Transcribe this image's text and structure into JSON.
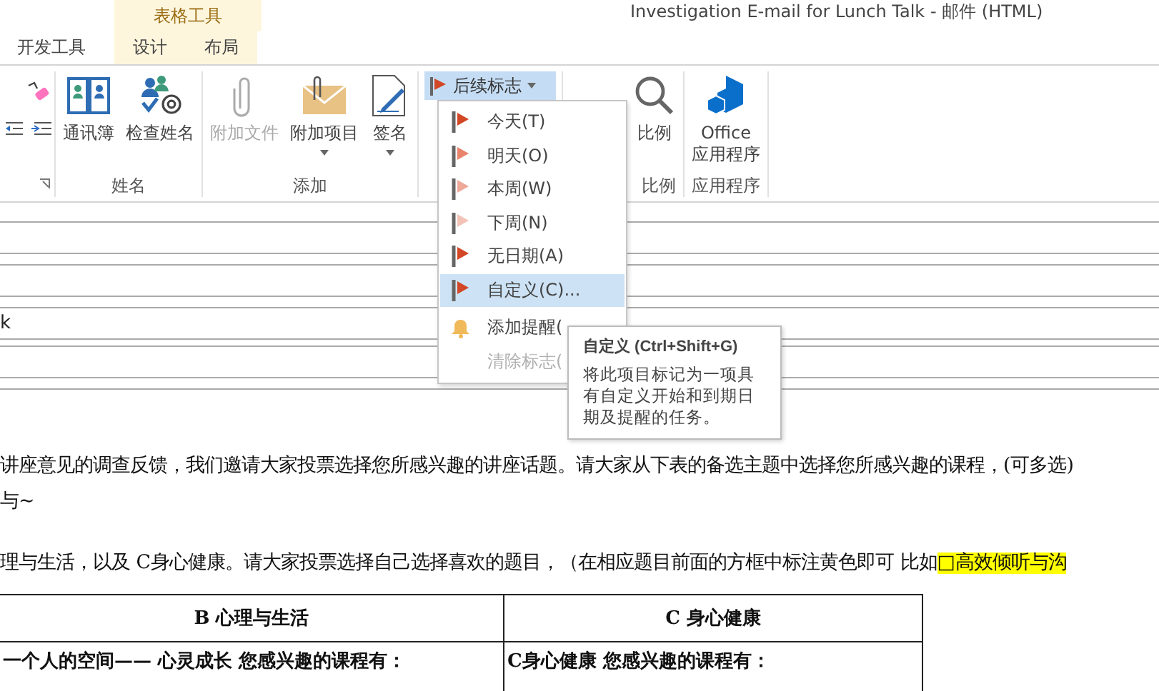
{
  "contextual_group": {
    "label": "表格工具"
  },
  "window": {
    "title": "Investigation E-mail for Lunch Talk - 邮件 (HTML)"
  },
  "tabs": [
    {
      "label": "开发工具",
      "selected": false,
      "contextual": false
    },
    {
      "label": "设计",
      "selected": false,
      "contextual": true
    },
    {
      "label": "布局",
      "selected": false,
      "contextual": true
    }
  ],
  "ribbon": {
    "groups": [
      {
        "label": "姓名",
        "buttons": [
          {
            "label": "通讯簿",
            "kind": "address-book",
            "disabled": false,
            "dropdown": false
          },
          {
            "label": "检查姓名",
            "kind": "check-names",
            "disabled": false,
            "dropdown": false
          }
        ]
      },
      {
        "label": "添加",
        "buttons": [
          {
            "label": "附加文件",
            "kind": "paperclip",
            "disabled": true,
            "dropdown": false
          },
          {
            "label": "附加项目",
            "kind": "envelope",
            "disabled": false,
            "dropdown": true
          },
          {
            "label": "签名",
            "kind": "signature",
            "disabled": false,
            "dropdown": true
          }
        ]
      },
      {
        "kind": "flag-group",
        "button": {
          "label": "后续标志",
          "open": true
        }
      },
      {
        "label": "比例",
        "buttons": [
          {
            "label": "比例",
            "kind": "zoom",
            "disabled": false,
            "dropdown": false
          }
        ]
      },
      {
        "label": "应用程序",
        "buttons": [
          {
            "label": "Office\n应用程序",
            "kind": "office",
            "disabled": false,
            "dropdown": false
          }
        ]
      }
    ]
  },
  "flag_menu": {
    "items": [
      {
        "kind": "flag",
        "label": "今天(T)",
        "color": "#d24726",
        "selected": false,
        "disabled": false
      },
      {
        "kind": "flag",
        "label": "明天(O)",
        "color": "#e8836c",
        "selected": false,
        "disabled": false
      },
      {
        "kind": "flag",
        "label": "本周(W)",
        "color": "#eea898",
        "selected": false,
        "disabled": false
      },
      {
        "kind": "flag",
        "label": "下周(N)",
        "color": "#f3c2b7",
        "selected": false,
        "disabled": false
      },
      {
        "kind": "flag",
        "label": "无日期(A)",
        "color": "#d24726",
        "selected": false,
        "disabled": false
      },
      {
        "kind": "flag",
        "label": "自定义(C)...",
        "color": "#d24726",
        "selected": true,
        "disabled": false
      },
      {
        "kind": "bell",
        "label": "添加提醒(",
        "selected": false,
        "disabled": false
      },
      {
        "kind": "plain",
        "label": "清除标志(",
        "selected": false,
        "disabled": true
      }
    ]
  },
  "tooltip": {
    "title": "自定义 (Ctrl+Shift+G)",
    "text": "将此项目标记为一项具有自定义开始和到期日期及提醒的任务。"
  },
  "subject": {
    "value": "k"
  },
  "body": {
    "paragraphs": [
      {
        "text": "讲座意见的调查反馈，我们邀请大家投票选择您所感兴趣的讲座话题。请大家从下表的备选主题中选择您所感兴趣的课程，(可多选)"
      },
      {
        "text": "与~"
      },
      {
        "text": "理与生活，以及 C身心健康。请大家投票选择自己选择喜欢的题目，（在相应题目前面的方框中标注黄色即可 比如",
        "highlight": "□高效倾听与沟"
      }
    ],
    "table": {
      "columns": [
        "B  心理与生活",
        "C  身心健康"
      ],
      "rows": [
        [
          "一个人的空间—— 心灵成长 您感兴趣的课程有：",
          "C身心健康 您感兴趣的课程有："
        ]
      ]
    }
  }
}
